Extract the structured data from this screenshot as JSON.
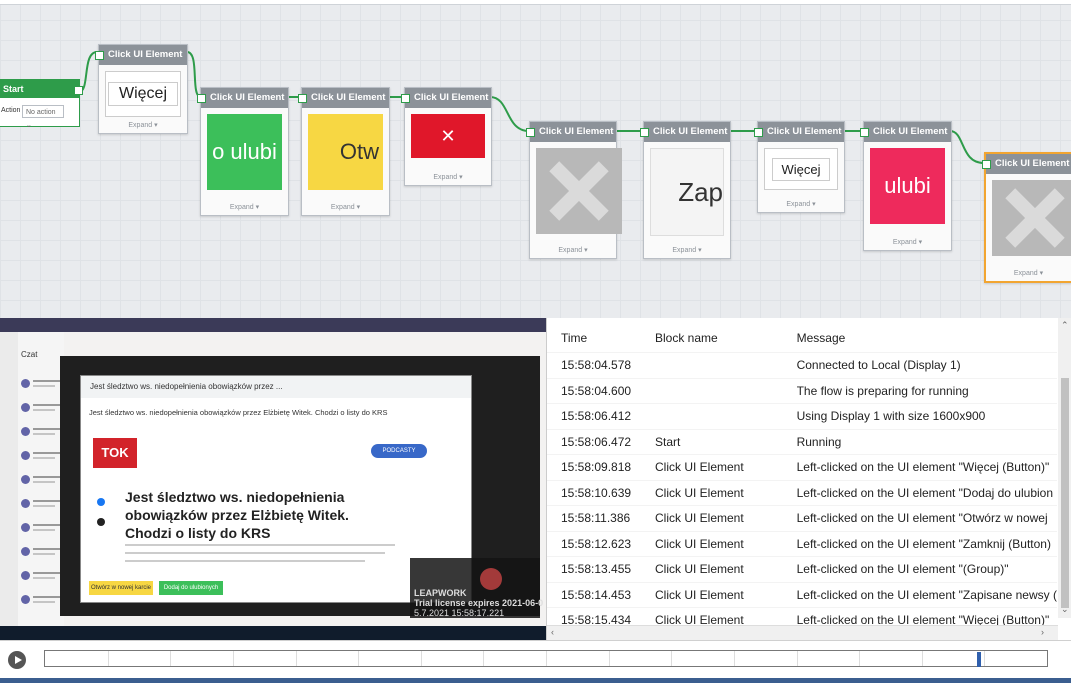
{
  "flow": {
    "start": {
      "title": "Start",
      "action_label": "Action",
      "action_value": "No action"
    },
    "block_title": "Click UI Element",
    "expand_label": "Expand ▾",
    "blocks": [
      {
        "thumb_text": "Więcej",
        "thumb_kind": "button"
      },
      {
        "thumb_text": "o ulubi",
        "thumb_kind": "green"
      },
      {
        "thumb_text": "Otw",
        "thumb_kind": "yellow"
      },
      {
        "thumb_text": "✕",
        "thumb_kind": "red"
      },
      {
        "thumb_text": "",
        "thumb_kind": "placeholder"
      },
      {
        "thumb_text": "Zap",
        "thumb_kind": "white"
      },
      {
        "thumb_text": "Więcej",
        "thumb_kind": "button"
      },
      {
        "thumb_text": "ulubi",
        "thumb_kind": "pink"
      },
      {
        "thumb_text": "",
        "thumb_kind": "placeholder"
      }
    ]
  },
  "screenshot": {
    "popup_tab": "Jest śledztwo ws. niedopełnienia obowiązków przez ...",
    "page_headline": "Jest śledztwo ws. niedopełnienia obowiązków przez Elżbietę Witek. Chodzi o listy do KRS",
    "article_title": "Jest śledztwo ws. niedopełnienia obowiązków przez Elżbietę Witek. Chodzi o listy do KRS",
    "logo": "TOK FM",
    "podcasty": "PODCASTY",
    "btn_yellow": "Otwórz w nowej karcie",
    "btn_green": "Dodaj do ulubionych",
    "license_lines": [
      "LEAPWORK",
      "Trial license expires 2021-06-0",
      "5.7.2021 15:58:17.221"
    ],
    "chat_header": "Czat"
  },
  "log": {
    "columns": [
      "Time",
      "Block name",
      "Message"
    ],
    "rows": [
      {
        "time": "15:58:04.578",
        "block": "",
        "message": "Connected to Local (Display 1)"
      },
      {
        "time": "15:58:04.600",
        "block": "",
        "message": "The flow is preparing for running"
      },
      {
        "time": "15:58:06.412",
        "block": "",
        "message": "Using Display 1 with size 1600x900"
      },
      {
        "time": "15:58:06.472",
        "block": "Start",
        "message": "Running"
      },
      {
        "time": "15:58:09.818",
        "block": "Click UI Element",
        "message": "Left-clicked on the UI element \"Więcej (Button)\""
      },
      {
        "time": "15:58:10.639",
        "block": "Click UI Element",
        "message": "Left-clicked on the UI element \"Dodaj do ulubion"
      },
      {
        "time": "15:58:11.386",
        "block": "Click UI Element",
        "message": "Left-clicked on the UI element \"Otwórz w nowej"
      },
      {
        "time": "15:58:12.623",
        "block": "Click UI Element",
        "message": "Left-clicked on the UI element \"Zamknij (Button)"
      },
      {
        "time": "15:58:13.455",
        "block": "Click UI Element",
        "message": "Left-clicked on the UI element \"(Group)\""
      },
      {
        "time": "15:58:14.453",
        "block": "Click UI Element",
        "message": "Left-clicked on the UI element \"Zapisane newsy ("
      },
      {
        "time": "15:58:15.434",
        "block": "Click UI Element",
        "message": "Left-clicked on the UI element \"Więcej (Button)\""
      }
    ]
  },
  "timeline": {
    "play_icon": "play-icon",
    "position_fraction": 0.93
  },
  "colors": {
    "accent_green": "#2e9c4a",
    "selected_orange": "#f2a531",
    "timeline_marker": "#2f5fad"
  }
}
